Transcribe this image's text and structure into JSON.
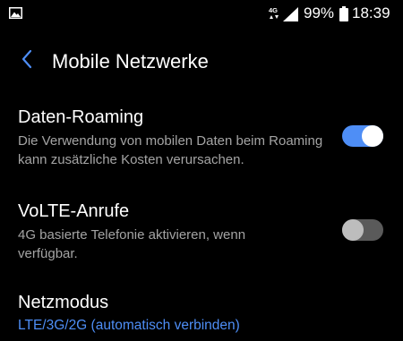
{
  "status_bar": {
    "network_type": "4G",
    "battery_percent": "99%",
    "time": "18:39",
    "left_icon": "gallery-icon",
    "signal_icon": "signal-icon",
    "battery_icon": "battery-icon"
  },
  "header": {
    "back_icon": "back-icon",
    "title": "Mobile Netzwerke"
  },
  "colors": {
    "background": "#000000",
    "accent": "#4e8ef6",
    "secondary_text": "#a4a4a4",
    "toggle_off_track": "#5a5a5a",
    "toggle_off_thumb": "#bdbdbd"
  },
  "settings": [
    {
      "title": "Daten-Roaming",
      "description": "Die Verwendung von mobilen Daten beim Roaming kann zusätzliche Kosten verursachen.",
      "toggle_on": true
    },
    {
      "title": "VoLTE-Anrufe",
      "description": "4G basierte Telefonie aktivieren, wenn verfügbar.",
      "toggle_on": false
    },
    {
      "title": "Netzmodus",
      "value": "LTE/3G/2G (automatisch verbinden)"
    }
  ]
}
